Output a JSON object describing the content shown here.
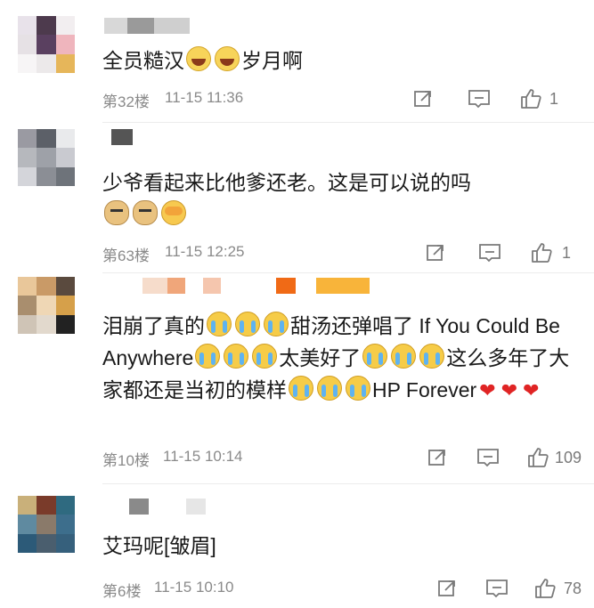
{
  "comments": [
    {
      "floor": "第32楼",
      "time": "11-15 11:36",
      "likes": "1",
      "content": [
        "全员糙汉",
        {
          "emoji": "laugh"
        },
        {
          "emoji": "laugh"
        },
        "岁月啊"
      ],
      "text_parts": {
        "a": "全员糙汉",
        "b": "岁月啊"
      }
    },
    {
      "floor": "第63楼",
      "time": "11-15 12:25",
      "likes": "1",
      "text_parts": {
        "a": "少爷看起来比他爹还老。这是可以说的吗"
      }
    },
    {
      "floor": "第10楼",
      "time": "11-15 10:14",
      "likes": "109",
      "text_parts": {
        "a": "泪崩了真的",
        "b": "甜汤还弹唱了 If You Could Be Anywhere",
        "c": "太美好了",
        "d": "这么多年了大家都还是当初的模样",
        "e": "HP Forever"
      }
    },
    {
      "floor": "第6楼",
      "time": "11-15 10:10",
      "likes": "78",
      "text_parts": {
        "a": "艾玛呢[皱眉]"
      }
    }
  ],
  "icons": {
    "share": "share-icon",
    "comment": "comment-icon",
    "like": "thumbs-up-icon"
  },
  "colors": {
    "text": "#1a1a1a",
    "meta": "#8a8a8a",
    "heart": "#e02424"
  }
}
